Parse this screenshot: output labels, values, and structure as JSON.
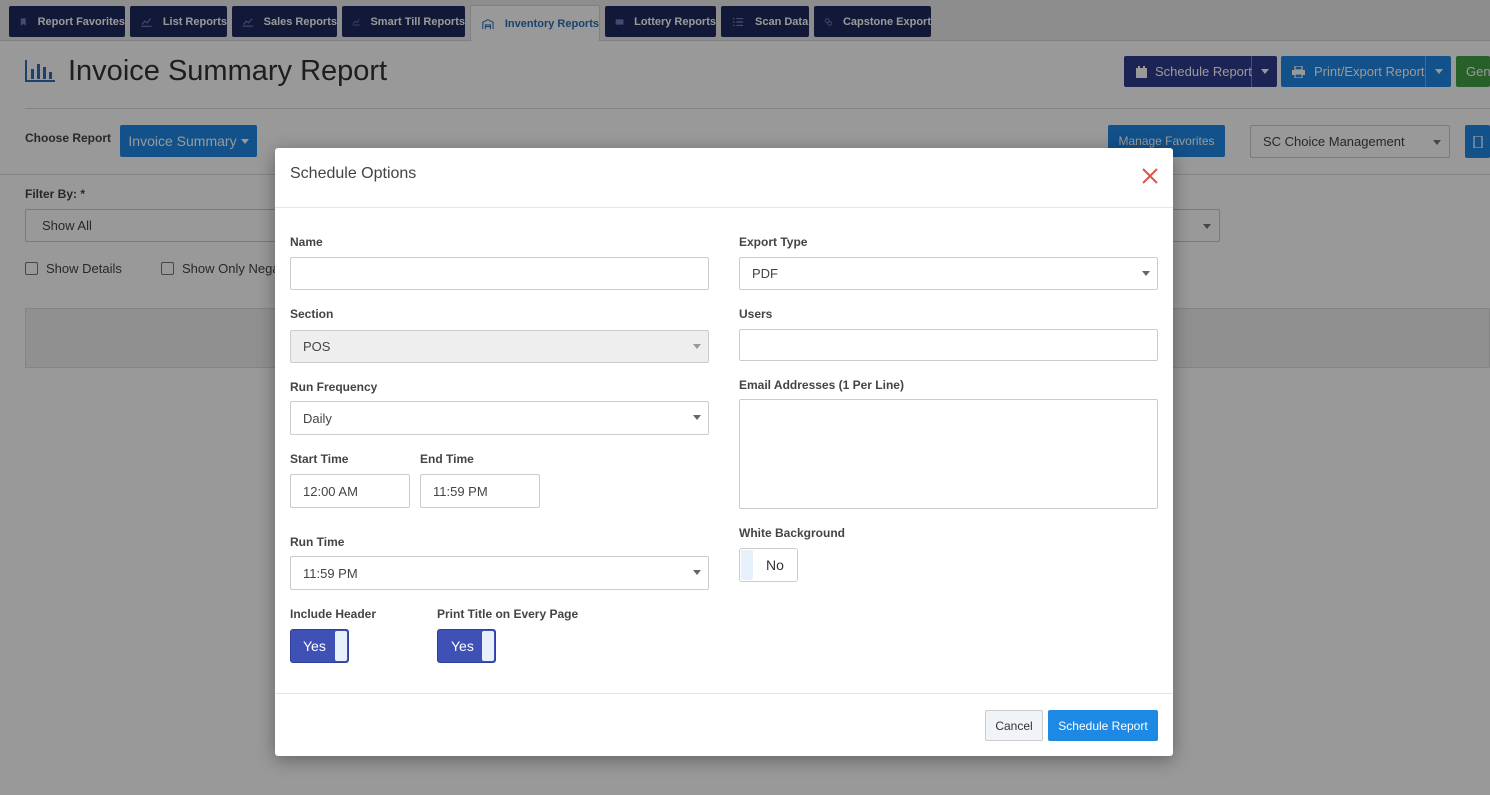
{
  "tabs": [
    {
      "label": "Report Favorites",
      "icon": "bookmark-icon"
    },
    {
      "label": "List Reports",
      "icon": "line-chart-icon"
    },
    {
      "label": "Sales Reports",
      "icon": "line-chart-icon"
    },
    {
      "label": "Smart Till Reports",
      "icon": "line-chart-icon"
    },
    {
      "label": "Inventory Reports",
      "icon": "warehouse-icon"
    },
    {
      "label": "Lottery Reports",
      "icon": "ticket-icon"
    },
    {
      "label": "Scan Data",
      "icon": "list-icon"
    },
    {
      "label": "Capstone Export",
      "icon": "link-icon"
    }
  ],
  "page": {
    "title": "Invoice Summary Report",
    "title_icon": "bar-chart-icon",
    "schedule_report_btn": "Schedule Report",
    "print_export_btn": "Print/Export Report",
    "generate_btn": "Gene",
    "choose_report_label": "Choose Report",
    "report_selector": "Invoice Summary",
    "manage_favorites": "Manage Favorites",
    "store_select": "SC Choice Management",
    "filter_by_label": "Filter By: *",
    "filter_value": "Show All",
    "show_details": "Show Details",
    "show_only_neg": "Show Only Nega"
  },
  "modal": {
    "title": "Schedule Options",
    "name_label": "Name",
    "name_value": "",
    "section_label": "Section",
    "section_value": "POS",
    "run_frequency_label": "Run Frequency",
    "run_frequency_value": "Daily",
    "start_time_label": "Start Time",
    "start_time_value": "12:00 AM",
    "end_time_label": "End Time",
    "end_time_value": "11:59 PM",
    "run_time_label": "Run Time",
    "run_time_value": "11:59 PM",
    "include_header_label": "Include Header",
    "include_header_value": "Yes",
    "print_title_label": "Print Title on Every Page",
    "print_title_value": "Yes",
    "export_type_label": "Export Type",
    "export_type_value": "PDF",
    "users_label": "Users",
    "users_value": "",
    "email_label": "Email Addresses (1 Per Line)",
    "email_value": "",
    "white_bg_label": "White Background",
    "white_bg_value": "No",
    "cancel_btn": "Cancel",
    "schedule_btn": "Schedule Report"
  },
  "colors": {
    "tab_bg": "#1f2b5e",
    "primary_blue": "#1e88e5",
    "toggle_on": "#3f51b5",
    "schedule_btn_bg": "#2f3d8f",
    "close_red": "#e0534a",
    "generate_green": "#43a047"
  }
}
